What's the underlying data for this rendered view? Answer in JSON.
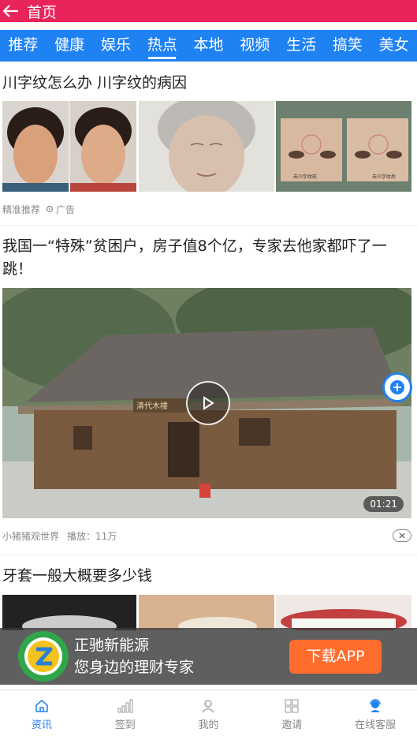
{
  "topbar": {
    "title": "首页"
  },
  "tabs": [
    "推荐",
    "健康",
    "娱乐",
    "热点",
    "本地",
    "视频",
    "生活",
    "搞笑",
    "美女"
  ],
  "article1": {
    "title": "川字纹怎么办 川字纹的病因",
    "source": "精准推荐",
    "ad_label": "广告",
    "img_caption_left": "去川字纹前",
    "img_caption_right": "去川字纹后"
  },
  "article2": {
    "title": "我国一“特殊”贫困户，房子值8个亿，专家去他家都吓了一跳！",
    "source": "小猪猪观世界",
    "plays": "播放：11万",
    "duration": "01:21",
    "sign_text": "清代木楼"
  },
  "article3": {
    "title": "牙套一般大概要多少钱"
  },
  "banner": {
    "line1": "正驰新能源",
    "line2": "您身边的理财专家",
    "button": "下载APP"
  },
  "bottomnav": [
    {
      "label": "资讯"
    },
    {
      "label": "签到"
    },
    {
      "label": "我的"
    },
    {
      "label": "邀请"
    },
    {
      "label": "在线客服"
    }
  ],
  "colors": {
    "topbar": "#e8245a",
    "tabs": "#1f82f2",
    "accent": "#1f82f2",
    "download": "#ff6c2c"
  }
}
